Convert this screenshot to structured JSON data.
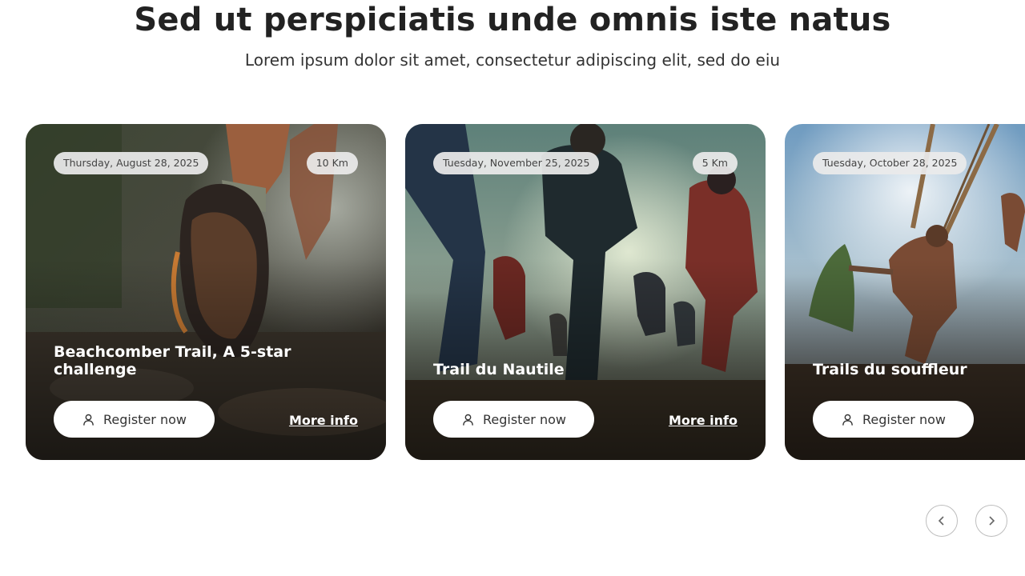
{
  "header": {
    "title": "Sed ut perspiciatis unde omnis iste natus",
    "subtitle": "Lorem ipsum dolor sit amet, consectetur adipiscing elit, sed do eiu"
  },
  "events": [
    {
      "date": "Thursday, August 28, 2025",
      "distance": "10 Km",
      "title": "Beachcomber Trail, A 5-star challenge",
      "register_label": "Register now",
      "more_info_label": "More info",
      "photo": "trail-running-shoe-photo"
    },
    {
      "date": "Tuesday, November 25, 2025",
      "distance": "5 Km",
      "title": "Trail du Nautile",
      "register_label": "Register now",
      "more_info_label": "More info",
      "photo": "group-of-runners-photo"
    },
    {
      "date": "Tuesday, October 28, 2025",
      "title": "Trails du souffleur",
      "register_label": "Register now",
      "photo": "obstacle-rope-climb-photo"
    }
  ],
  "carousel": {
    "prev_icon": "chevron-left-icon",
    "next_icon": "chevron-right-icon"
  },
  "colors": {
    "heading": "#222222",
    "badge_bg": "#ebebeb",
    "button_bg": "#ffffff",
    "nav_border": "#bdbdbd"
  }
}
